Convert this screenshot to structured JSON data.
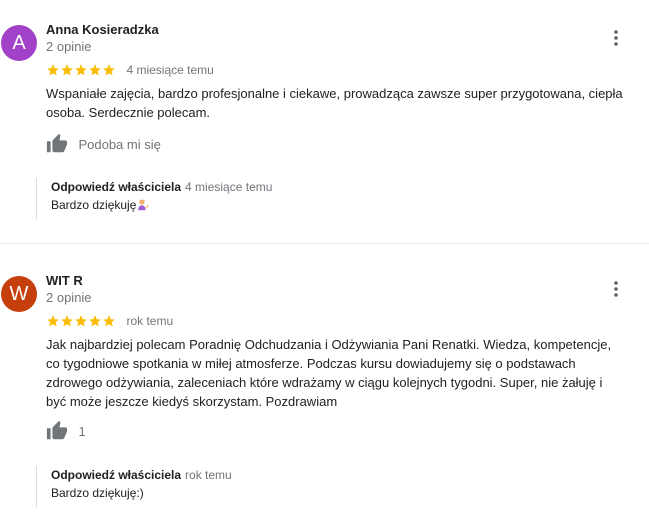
{
  "reviews": [
    {
      "avatar_letter": "A",
      "avatar_color": "#a142c8",
      "name": "Anna Kosieradzka",
      "review_count": "2 opinie",
      "stars": 5,
      "time": "4 miesiące temu",
      "text": "Wspaniałe zajęcia, bardzo profesjonalne i ciekawe, prowadząca zawsze super przygotowana, ciepła osoba. Serdecznie polecam.",
      "like_label": "Podoba mi się",
      "owner_reply": {
        "title": "Odpowiedź właściciela",
        "time": "4 miesiące temu",
        "text": "Bardzo dziękuję"
      }
    },
    {
      "avatar_letter": "W",
      "avatar_color": "#c43f0c",
      "name": "WIT R",
      "review_count": "2 opinie",
      "stars": 5,
      "time": "rok temu",
      "text": "Jak najbardziej polecam Poradnię Odchudzania i Odżywiania Pani Renatki. Wiedza, kompetencje, co tygodniowe spotkania w miłej atmosferze. Podczas kursu dowiadujemy się o podstawach zdrowego odżywiania, zaleceniach które wdrażamy w ciągu kolejnych tygodni. Super, nie żałuję i być może jeszcze kiedyś skorzystam. Pozdrawiam",
      "like_label": "1",
      "owner_reply": {
        "title": "Odpowiedź właściciela",
        "time": "rok temu",
        "text": "Bardzo dziękuję:)"
      }
    }
  ],
  "colors": {
    "star": "#fbbc04",
    "muted_text": "#70757a",
    "icon": "#70757a"
  },
  "icons": {
    "more": "more-vert-icon",
    "like": "thumb-up-icon",
    "emoji": "person-tipping-hand-emoji"
  }
}
